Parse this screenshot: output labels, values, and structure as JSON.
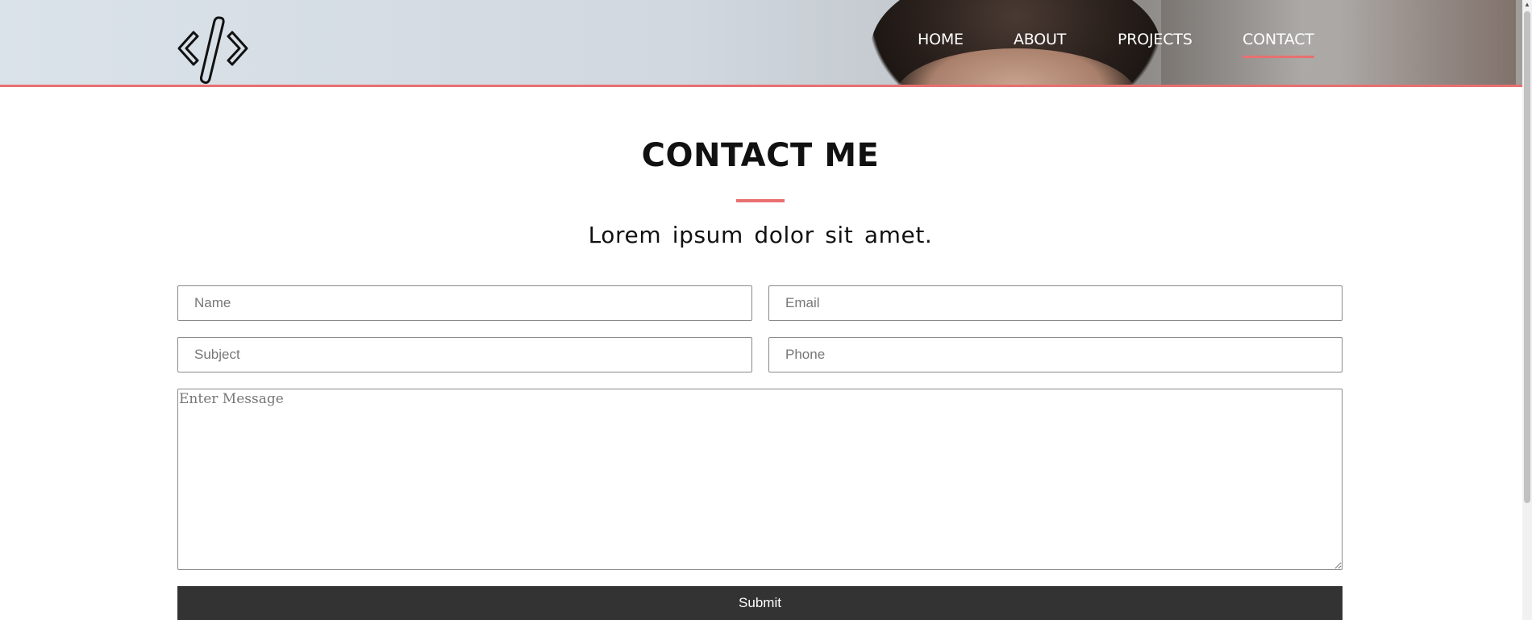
{
  "header": {
    "logo_icon": "code-brackets-icon",
    "nav": [
      {
        "label": "HOME",
        "active": false
      },
      {
        "label": "ABOUT",
        "active": false
      },
      {
        "label": "PROJECTS",
        "active": false
      },
      {
        "label": "CONTACT",
        "active": true
      }
    ]
  },
  "contact": {
    "title": "CONTACT ME",
    "subtitle": "Lorem ipsum dolor sit amet.",
    "fields": {
      "name_placeholder": "Name",
      "email_placeholder": "Email",
      "subject_placeholder": "Subject",
      "phone_placeholder": "Phone",
      "message_placeholder": "Enter Message"
    },
    "submit_label": "Submit"
  },
  "colors": {
    "accent": "#e87070",
    "button": "#333333",
    "text": "#111111"
  }
}
